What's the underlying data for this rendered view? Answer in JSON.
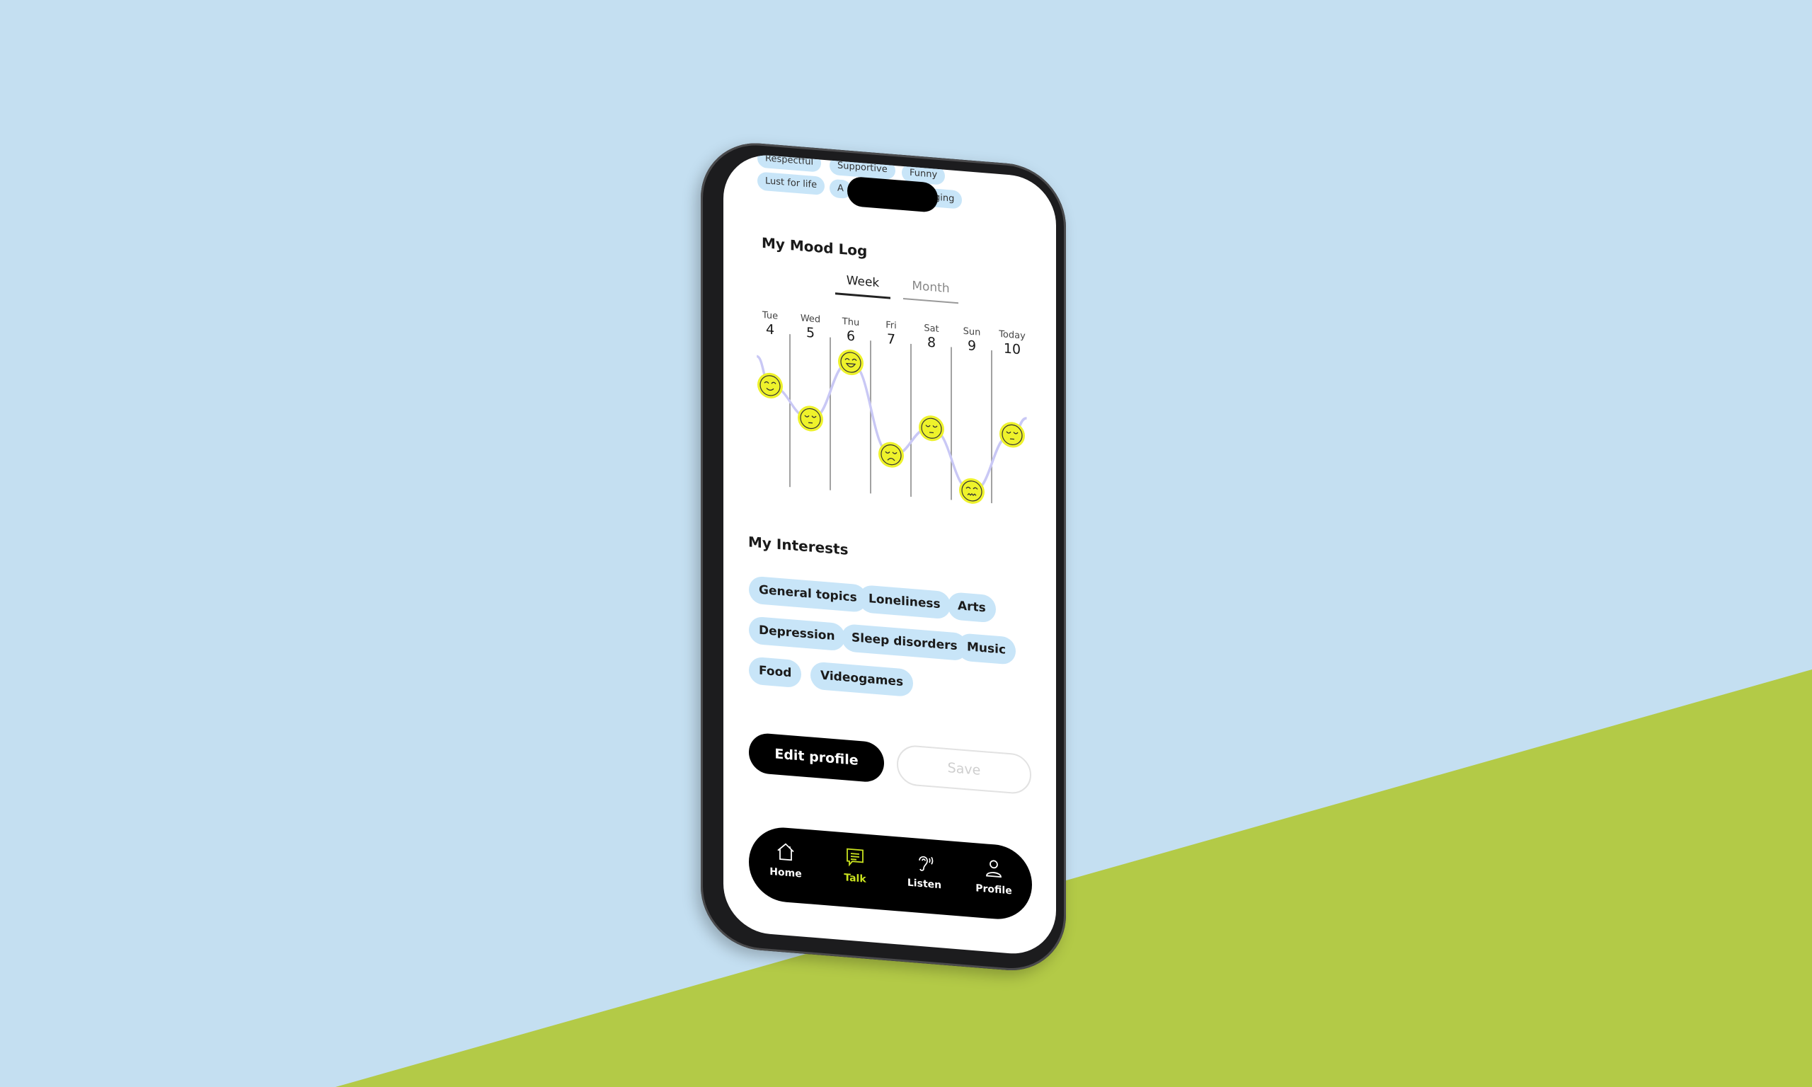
{
  "top_tags": {
    "row0": [
      "Respectful",
      "Supportive",
      "Funny"
    ],
    "row1": [
      "Lust for life",
      "A",
      "ging"
    ]
  },
  "mood_log": {
    "title": "My Mood Log",
    "tabs": [
      {
        "label": "Week",
        "active": true
      },
      {
        "label": "Month",
        "active": false
      }
    ],
    "days": [
      {
        "weekday": "Tue",
        "date": "4",
        "mood": 4,
        "face": "smiling"
      },
      {
        "weekday": "Wed",
        "date": "5",
        "mood": 3,
        "face": "calm"
      },
      {
        "weekday": "Thu",
        "date": "6",
        "mood": 5,
        "face": "laughing"
      },
      {
        "weekday": "Fri",
        "date": "7",
        "mood": 2,
        "face": "sad"
      },
      {
        "weekday": "Sat",
        "date": "8",
        "mood": 3,
        "face": "calm"
      },
      {
        "weekday": "Sun",
        "date": "9",
        "mood": 1,
        "face": "anxious"
      },
      {
        "weekday": "Today",
        "date": "10",
        "mood": 3,
        "face": "calm"
      }
    ],
    "colors": {
      "face": "#eef22b",
      "line": "#c9c8f5"
    }
  },
  "interests": {
    "title": "My Interests",
    "tags": [
      "General topics",
      "Loneliness",
      "Arts",
      "Depression",
      "Sleep disorders",
      "Music",
      "Food",
      "Videogames"
    ]
  },
  "actions": {
    "edit_profile": "Edit profile",
    "save": "Save"
  },
  "nav": {
    "items": [
      {
        "label": "Home",
        "icon": "home-icon",
        "active": false
      },
      {
        "label": "Talk",
        "icon": "chat-icon",
        "active": true
      },
      {
        "label": "Listen",
        "icon": "ear-icon",
        "active": false
      },
      {
        "label": "Profile",
        "icon": "person-icon",
        "active": false
      }
    ],
    "active_color": "#c9e21f"
  }
}
